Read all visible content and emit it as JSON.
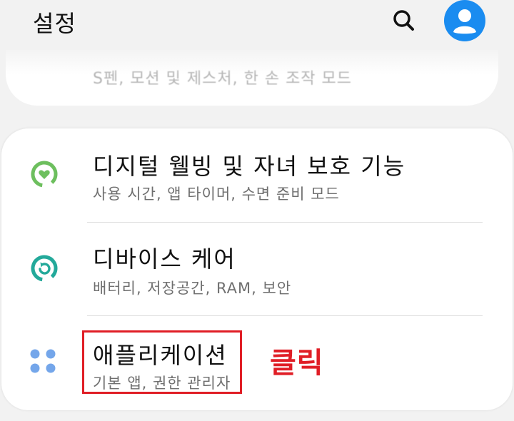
{
  "header": {
    "title": "설정"
  },
  "top_card": {
    "subtitle": "S펜, 모션 및 제스처, 한 손 조작 모드"
  },
  "items": [
    {
      "title": "디지털 웰빙 및 자녀 보호 기능",
      "subtitle": "사용 시간, 앱 타이머, 수면 준비 모드",
      "icon": "digital-wellbeing-icon",
      "icon_color": "#6dbf5e"
    },
    {
      "title": "디바이스 케어",
      "subtitle": "배터리, 저장공간, RAM, 보안",
      "icon": "device-care-icon",
      "icon_color": "#23a99a"
    },
    {
      "title": "애플리케이션",
      "subtitle": "기본 앱, 권한 관리자",
      "icon": "apps-grid-icon",
      "icon_color": "#74a6ea"
    }
  ],
  "annotation": {
    "label": "클릭",
    "color": "#e01e26"
  },
  "colors": {
    "avatar": "#1a8cf0",
    "background": "#f2f2f2"
  }
}
